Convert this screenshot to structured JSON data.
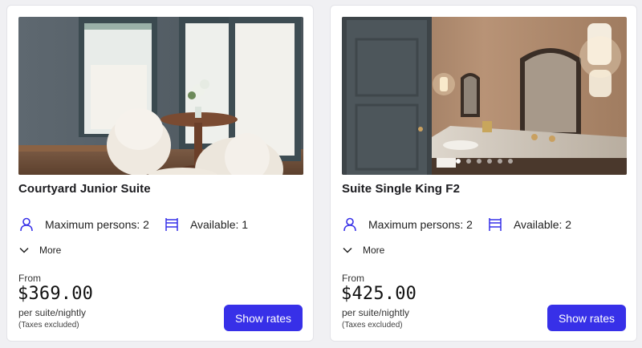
{
  "accent_color": "#3730e8",
  "rooms": [
    {
      "name": "Courtyard Junior Suite",
      "features": [
        {
          "icon": "person-icon",
          "label": "Maximum persons: 2"
        },
        {
          "icon": "bed-icon",
          "label": "Available: 1"
        }
      ],
      "more_label": "More",
      "from_label": "From",
      "price": "$369.00",
      "per_label": "per suite/nightly",
      "tax_note": "(Taxes excluded)",
      "cta_label": "Show rates"
    },
    {
      "name": "Suite Single King F2",
      "features": [
        {
          "icon": "person-icon",
          "label": "Maximum persons: 2"
        },
        {
          "icon": "bed-icon",
          "label": "Available: 2"
        }
      ],
      "more_label": "More",
      "from_label": "From",
      "price": "$425.00",
      "per_label": "per suite/nightly",
      "tax_note": "(Taxes excluded)",
      "cta_label": "Show rates",
      "carousel": {
        "slides": 6,
        "active": 1
      }
    }
  ]
}
